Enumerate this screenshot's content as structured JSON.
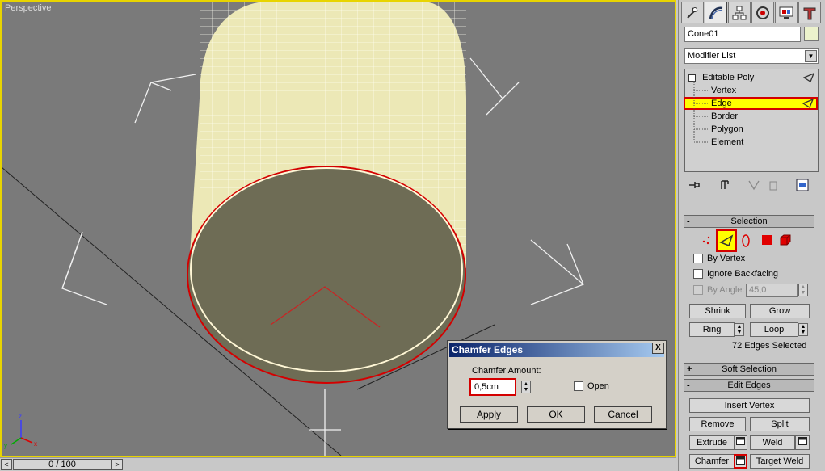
{
  "viewport": {
    "label": "Perspective"
  },
  "timeline": {
    "frame": "0 / 100",
    "prev": "<",
    "next": ">"
  },
  "panel": {
    "object_name": "Cone01",
    "modifier_list": "Modifier List",
    "tabs": [
      "create-icon",
      "modify-icon",
      "hierarchy-icon",
      "motion-icon",
      "display-icon",
      "utilities-icon"
    ],
    "stack": {
      "root": "Editable Poly",
      "items": [
        "Vertex",
        "Edge",
        "Border",
        "Polygon",
        "Element"
      ],
      "selected": "Edge"
    },
    "selection": {
      "title": "Selection",
      "by_vertex": "By Vertex",
      "ignore_backfacing": "Ignore Backfacing",
      "by_angle": "By Angle:",
      "angle_value": "45,0",
      "shrink": "Shrink",
      "grow": "Grow",
      "ring": "Ring",
      "loop": "Loop",
      "status": "72 Edges Selected"
    },
    "soft_selection": {
      "title": "Soft Selection",
      "sign": "+"
    },
    "edit_edges": {
      "title": "Edit Edges",
      "sign": "-",
      "insert_vertex": "Insert Vertex",
      "remove": "Remove",
      "split": "Split",
      "extrude": "Extrude",
      "weld": "Weld",
      "chamfer": "Chamfer",
      "target_weld": "Target Weld"
    },
    "selection_sign": "-"
  },
  "dialog": {
    "title": "Chamfer Edges",
    "close": "X",
    "amount_label": "Chamfer Amount:",
    "amount_value": "0,5cm",
    "open_label": "Open",
    "apply": "Apply",
    "ok": "OK",
    "cancel": "Cancel"
  },
  "colors": {
    "accent_yellow": "#ffff00",
    "highlight_red": "#d40000",
    "viewport_border": "#e8d400"
  }
}
